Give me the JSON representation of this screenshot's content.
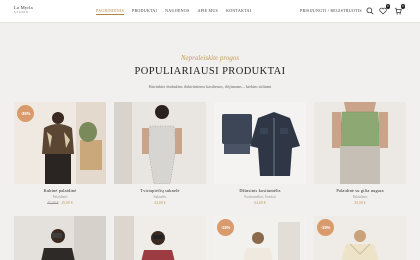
{
  "header": {
    "logo_line1": "La Myrla",
    "logo_line2": "STUDIO",
    "nav": [
      "PAGRINDINIS",
      "PRODUKTAI",
      "NAUJIENOS",
      "APIE MUS",
      "KONTAKTAI"
    ],
    "account": "PRISIJUNGTI / REGISTRUOTIS",
    "wishlist_count": "0",
    "cart_count": "0",
    "icons": [
      "search-icon",
      "heart-icon",
      "cart-icon"
    ]
  },
  "section": {
    "subtitle": "Nepraleiskite progos",
    "title": "POPULIARIAUSI PRODUKTAI",
    "description": "Išsirinkite drabužius išskirtiniems kasdienos, išėjimams – kiekim stiliumi"
  },
  "products": [
    {
      "name": "Kubinė palaidinė",
      "category": "Palaidinės",
      "old_price": "45,00 €",
      "price": "29,00 €",
      "sale": "-35%"
    },
    {
      "name": "Tvirtapiečių suknelė",
      "category": "Suknelės",
      "old_price": "",
      "price": "44,00 €",
      "sale": ""
    },
    {
      "name": "Džinsinis kostiumėlis",
      "category": "Kostiumėliai, Švarkai",
      "old_price": "",
      "price": "64,00 €",
      "sale": ""
    },
    {
      "name": "Palaidinė su gilia nugara",
      "category": "Palaidinės",
      "old_price": "",
      "price": "30,00 €",
      "sale": ""
    }
  ],
  "row2_sales": [
    "",
    "",
    "-15%",
    "-15%"
  ],
  "colors": {
    "accent": "#c39a5a",
    "sale_badge": "#d99a6c",
    "background": "#f1f0ee"
  }
}
